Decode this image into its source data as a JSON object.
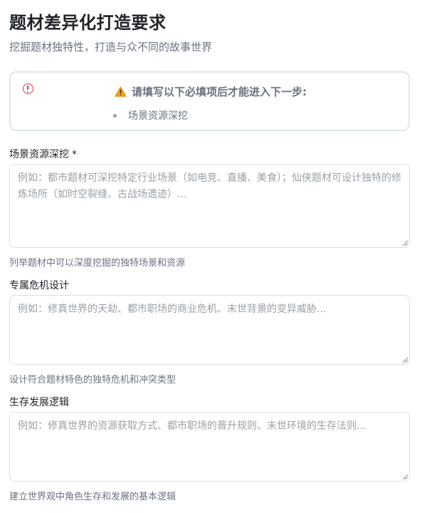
{
  "header": {
    "title": "题材差异化打造要求",
    "subtitle": "挖掘题材独特性，打造与众不同的故事世界"
  },
  "alert": {
    "icon": "error-circle-icon",
    "warning_icon": "warning-triangle-icon",
    "title": "请填写以下必填项后才能进入下一步:",
    "items": [
      "场景资源深挖"
    ],
    "colors": {
      "error": "#dc3545",
      "warning": "#f0a020",
      "border": "#dfe6e4"
    }
  },
  "fields": [
    {
      "label": "场景资源深挖",
      "required_mark": "*",
      "placeholder": "例如：都市题材可深挖特定行业场景（如电竞、直播、美食）；仙侠题材可设计独特的修炼场所（如时空裂缝、古战场遗迹）...",
      "value": "",
      "help": "列举题材中可以深度挖掘的独特场景和资源"
    },
    {
      "label": "专属危机设计",
      "placeholder": "例如：修真世界的天劫、都市职场的商业危机、末世背景的变异威胁...",
      "value": "",
      "help": "设计符合题材特色的独特危机和冲突类型"
    },
    {
      "label": "生存发展逻辑",
      "placeholder": "例如：修真世界的资源获取方式、都市职场的晋升规则、末世环境的生存法则...",
      "value": "",
      "help": "建立世界观中角色生存和发展的基本逻辑"
    }
  ]
}
